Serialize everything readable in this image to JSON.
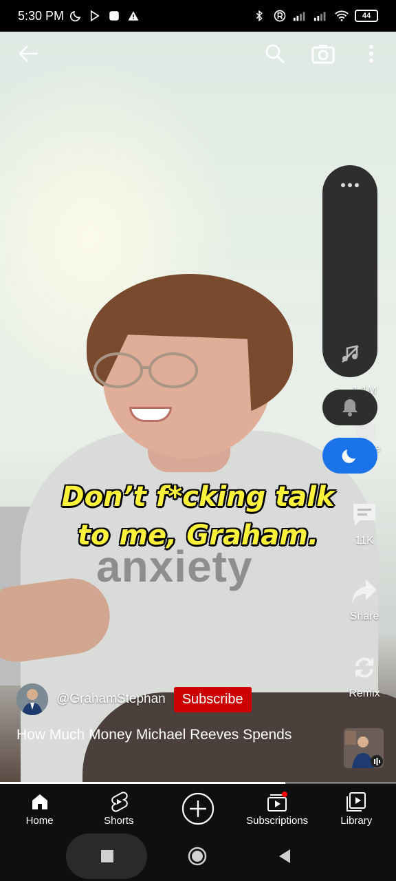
{
  "status_bar": {
    "time": "5:30 PM",
    "battery": "44"
  },
  "video": {
    "caption_line1": "Don’t f*cking talk",
    "caption_line2": "to me, Graham.",
    "shirt_text": "anxiety"
  },
  "top_controls": {
    "back_icon": "arrow-left-icon",
    "search_icon": "search-icon",
    "camera_icon": "camera-icon",
    "more_icon": "more-vert-icon"
  },
  "floating_panel": {
    "menu_icon": "more-horiz-icon",
    "music_icon": "music-off-icon"
  },
  "rail": {
    "like_count": "1.1M",
    "dislike_label": "Dislike",
    "comments_count": "11K",
    "share_label": "Share",
    "remix_label": "Remix"
  },
  "channel": {
    "handle": "@GrahamStephan",
    "subscribe_label": "Subscribe"
  },
  "title": "How Much Money Michael Reeves Spends",
  "progress": 0.72,
  "bottom_nav": [
    {
      "label": "Home",
      "icon": "home-icon"
    },
    {
      "label": "Shorts",
      "icon": "shorts-icon"
    },
    {
      "label": "",
      "icon": "create-icon"
    },
    {
      "label": "Subscriptions",
      "icon": "subscriptions-icon"
    },
    {
      "label": "Library",
      "icon": "library-icon"
    }
  ],
  "colors": {
    "accent_blue": "#1a73e8",
    "subscribe_red": "#cc0000",
    "caption_yellow": "#fff23a"
  }
}
